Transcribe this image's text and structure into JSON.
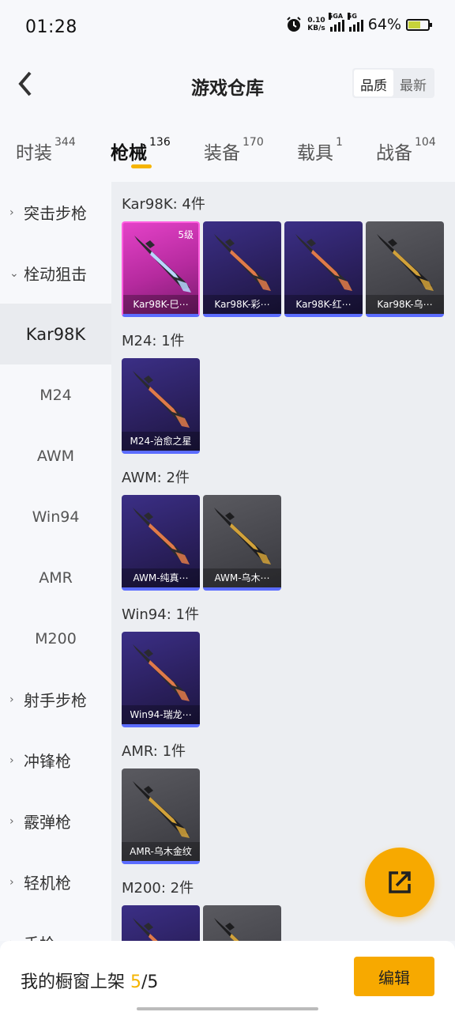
{
  "status_bar": {
    "time": "01:28",
    "net_speed_value": "0.10",
    "net_speed_unit": "KB/s",
    "sig1_label": "5GA",
    "sig2_label": "5G",
    "battery": "64%",
    "battery_level": 0.64
  },
  "header": {
    "title": "游戏仓库",
    "sort_options": [
      "品质",
      "最新"
    ],
    "active_sort": "品质"
  },
  "tabs": [
    {
      "label": "时装",
      "count": "344"
    },
    {
      "label": "枪械",
      "count": "136"
    },
    {
      "label": "装备",
      "count": "170"
    },
    {
      "label": "载具",
      "count": "1"
    },
    {
      "label": "战备",
      "count": "104"
    }
  ],
  "active_tab": "枪械",
  "sidebar": [
    {
      "label": "突击步枪",
      "kind": "category",
      "expanded": false
    },
    {
      "label": "栓动狙击",
      "kind": "category",
      "expanded": true
    },
    {
      "label": "Kar98K",
      "kind": "sub",
      "active": true
    },
    {
      "label": "M24",
      "kind": "sub"
    },
    {
      "label": "AWM",
      "kind": "sub"
    },
    {
      "label": "Win94",
      "kind": "sub"
    },
    {
      "label": "AMR",
      "kind": "sub"
    },
    {
      "label": "M200",
      "kind": "sub"
    },
    {
      "label": "射手步枪",
      "kind": "category",
      "expanded": false
    },
    {
      "label": "冲锋枪",
      "kind": "category",
      "expanded": false
    },
    {
      "label": "霰弹枪",
      "kind": "category",
      "expanded": false
    },
    {
      "label": "轻机枪",
      "kind": "category",
      "expanded": false
    },
    {
      "label": "手枪",
      "kind": "category",
      "expanded": false
    }
  ],
  "groups": [
    {
      "title": "Kar98K: 4件",
      "items": [
        {
          "label": "Kar98K-巳⋯",
          "rarity": "pink",
          "level": "5级"
        },
        {
          "label": "Kar98K-彩⋯",
          "rarity": "purple"
        },
        {
          "label": "Kar98K-红⋯",
          "rarity": "purple"
        },
        {
          "label": "Kar98K-乌⋯",
          "rarity": "gray"
        }
      ]
    },
    {
      "title": "M24: 1件",
      "items": [
        {
          "label": "M24-治愈之星",
          "rarity": "purple"
        }
      ]
    },
    {
      "title": "AWM: 2件",
      "items": [
        {
          "label": "AWM-纯真⋯",
          "rarity": "purple"
        },
        {
          "label": "AWM-乌木⋯",
          "rarity": "gray"
        }
      ]
    },
    {
      "title": "Win94: 1件",
      "items": [
        {
          "label": "Win94-瑞龙⋯",
          "rarity": "purple"
        }
      ]
    },
    {
      "title": "AMR: 1件",
      "items": [
        {
          "label": "AMR-乌木金纹",
          "rarity": "gray"
        }
      ]
    },
    {
      "title": "M200: 2件",
      "items": [
        {
          "label": "",
          "rarity": "purple"
        },
        {
          "label": "",
          "rarity": "gray"
        }
      ]
    }
  ],
  "bottom": {
    "showcase_prefix": "我的橱窗上架",
    "showcase_current": "5",
    "showcase_total": "/5",
    "edit_label": "编辑"
  },
  "colors": {
    "accent": "#f7a900",
    "indicator": "#f5b400",
    "rarity_pink": "#e442c8",
    "rarity_purple": "#3b2f86",
    "rarity_gray": "#4a4a50"
  }
}
